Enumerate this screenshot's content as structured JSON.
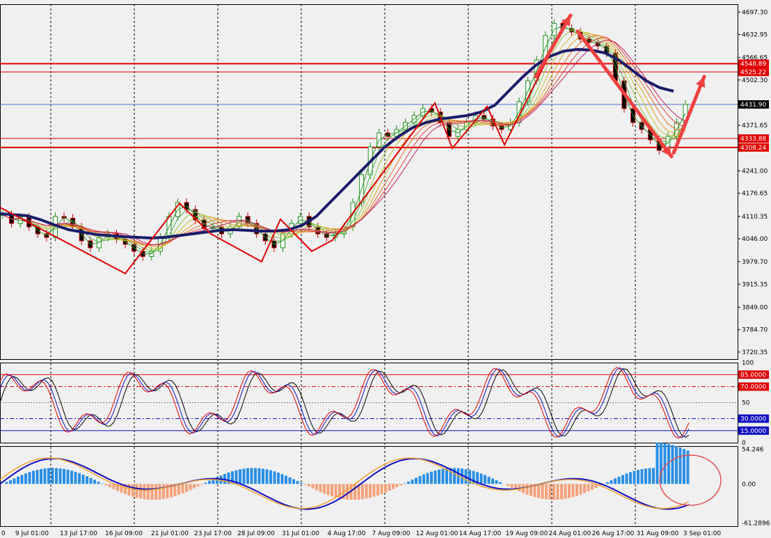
{
  "chart_data": [
    {
      "type": "candlestick",
      "panel": "price",
      "price_ticks": [
        "4697.30",
        "4632.95",
        "4566.65",
        "4502.30",
        "4371.65",
        "4241.00",
        "4176.65",
        "4110.35",
        "4046.00",
        "3979.70",
        "3915.35",
        "3849.00",
        "3784.70",
        "3720.35"
      ],
      "current_price": "4431.90",
      "levels": [
        {
          "value": "4548.89",
          "color": "#e00000",
          "style": "thick"
        },
        {
          "value": "4525.22",
          "color": "#e00000",
          "style": "thin"
        },
        {
          "value": "4431.90",
          "color": "#4a6fd0",
          "style": "thin"
        },
        {
          "value": "4333.88",
          "color": "#e00000",
          "style": "thin"
        },
        {
          "value": "4308.24",
          "color": "#e00000",
          "style": "thick"
        }
      ],
      "ohlc_close_approx": [
        4115,
        4090,
        4108,
        4080,
        4060,
        4050,
        4110,
        4105,
        4080,
        4040,
        4020,
        4050,
        4060,
        4045,
        4030,
        4010,
        3995,
        4010,
        4050,
        4110,
        4150,
        4130,
        4100,
        4075,
        4080,
        4060,
        4080,
        4110,
        4090,
        4060,
        4040,
        4020,
        4060,
        4090,
        4110,
        4080,
        4060,
        4050,
        4060,
        4080,
        4150,
        4230,
        4310,
        4350,
        4340,
        4360,
        4380,
        4400,
        4420,
        4410,
        4380,
        4340,
        4360,
        4380,
        4400,
        4390,
        4370,
        4360,
        4380,
        4440,
        4500,
        4560,
        4630,
        4665,
        4650,
        4640,
        4620,
        4610,
        4600,
        4580,
        4500,
        4420,
        4380,
        4360,
        4330,
        4300,
        4340,
        4380,
        4432
      ],
      "ma_thick_approx": [
        4118,
        4115,
        4112,
        4100,
        4085,
        4072,
        4065,
        4058,
        4055,
        4052,
        4050,
        4048,
        4050,
        4055,
        4060,
        4065,
        4070,
        4072,
        4070,
        4068,
        4068,
        4072,
        4085,
        4110,
        4150,
        4190,
        4230,
        4270,
        4310,
        4340,
        4365,
        4380,
        4390,
        4395,
        4400,
        4410,
        4430,
        4470,
        4510,
        4545,
        4570,
        4585,
        4590,
        4588,
        4580,
        4560,
        4530,
        4500,
        4480,
        4470
      ],
      "annotations": [
        "zigzag-lines",
        "red-arrows"
      ]
    },
    {
      "type": "line",
      "panel": "oscillator",
      "ticks": [
        "100",
        "50",
        "0"
      ],
      "levels": [
        "85.0000",
        "70.0000",
        "30.0000",
        "15.0000"
      ]
    },
    {
      "type": "histogram+line",
      "panel": "macd",
      "ticks": [
        "54.246",
        "0.00",
        "-61.2896"
      ]
    }
  ],
  "x_labels": [
    "0",
    "9 Jul 01:00",
    "13 Jul 17:00",
    "16 Jul 09:00",
    "21 Jul 01:00",
    "23 Jul 17:00",
    "28 Jul 09:00",
    "31 Jul 01:00",
    "4 Aug 17:00",
    "7 Aug 09:00",
    "12 Aug 01:00",
    "14 Aug 17:00",
    "19 Aug 09:00",
    "24 Aug 01:00",
    "26 Aug 17:00",
    "31 Aug 09:00",
    "3 Sep 01:00"
  ],
  "colors": {
    "up": "#1a8f1a",
    "down": "#c00000",
    "ma": "#1c1c6b",
    "macd_pos": "#2a8fe6",
    "macd_neg": "#f5a27a"
  }
}
